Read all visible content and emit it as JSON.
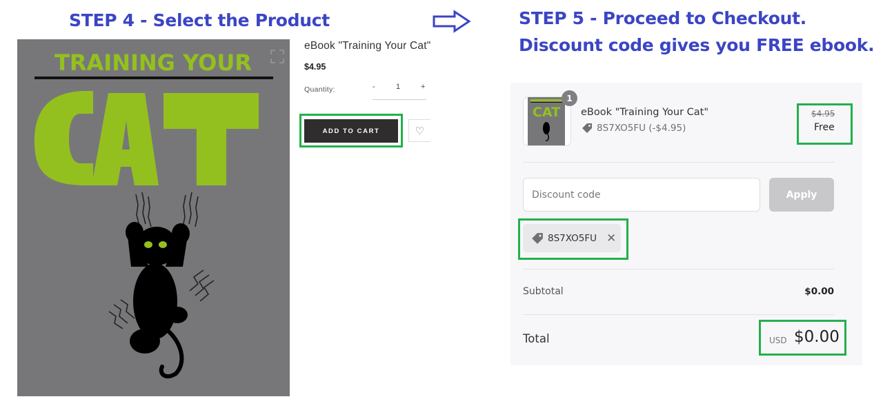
{
  "step4": {
    "title": "STEP 4 - Select the Product"
  },
  "step5": {
    "title_line1": "STEP 5 - Proceed to Checkout.",
    "title_line2": "Discount code gives you FREE ebook."
  },
  "cover": {
    "top_text": "TRAINING YOUR",
    "main_text": "CAT",
    "bg_color": "#777779",
    "accent_color": "#93c01f"
  },
  "product": {
    "title": "eBook \"Training Your Cat\"",
    "price": "$4.95",
    "quantity_label": "Quantity:",
    "quantity_minus": "-",
    "quantity_value": "1",
    "quantity_plus": "+",
    "add_to_cart_label": "ADD TO CART",
    "wishlist_icon": "heart-icon"
  },
  "checkout": {
    "item": {
      "quantity_badge": "1",
      "title": "eBook \"Training Your Cat\"",
      "discount_line": "8S7XO5FU (-$4.95)",
      "original_price": "$4.95",
      "final_price": "Free"
    },
    "discount_field": {
      "placeholder": "Discount code",
      "value": ""
    },
    "apply_label": "Apply",
    "applied_code": "8S7XO5FU",
    "subtotal_label": "Subtotal",
    "subtotal_value": "$0.00",
    "total_label": "Total",
    "total_currency": "USD",
    "total_value": "$0.00"
  },
  "colors": {
    "step_title": "#3b45c4",
    "highlight": "#22b04b"
  }
}
